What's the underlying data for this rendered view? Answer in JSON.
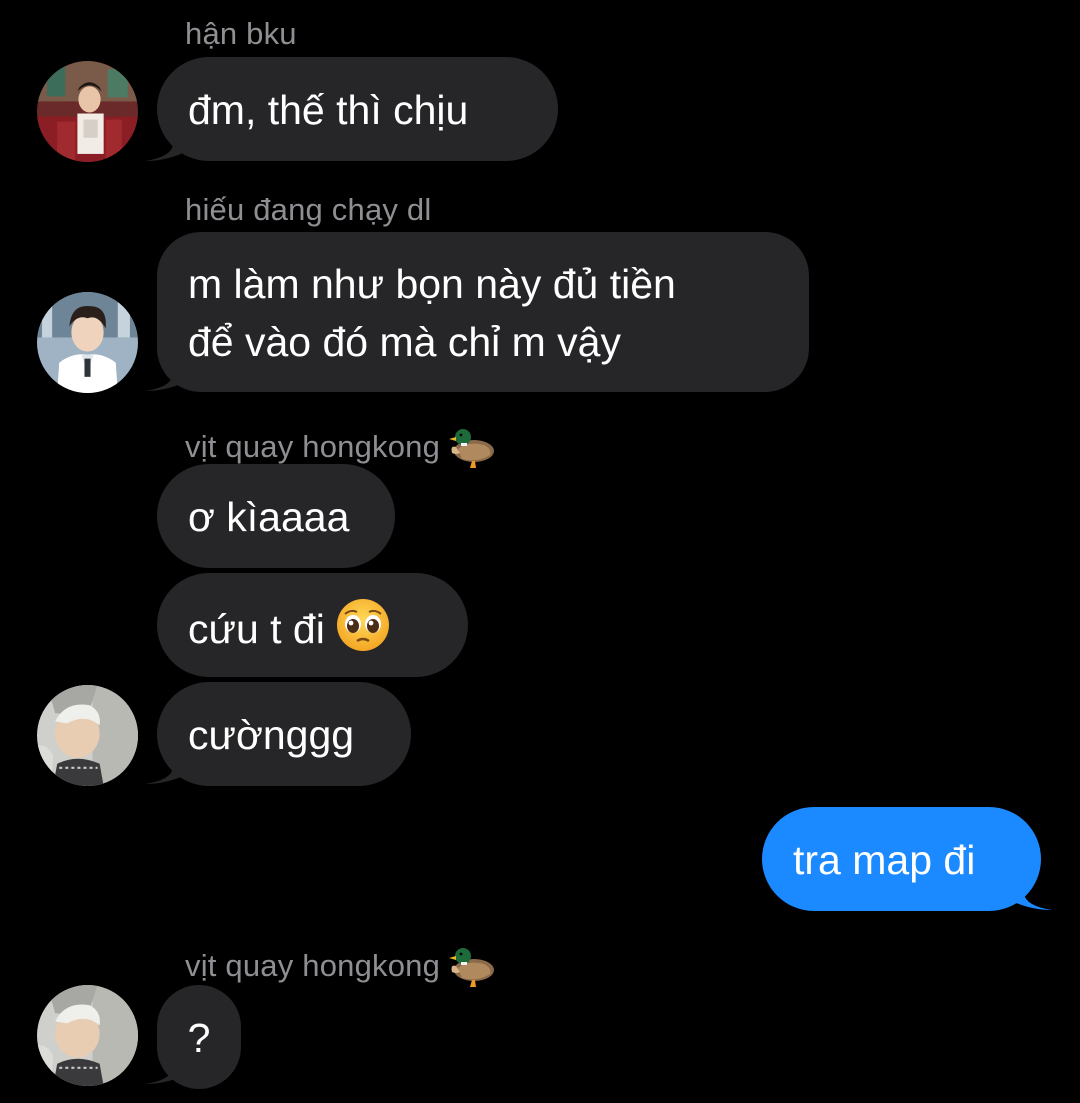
{
  "messages": [
    {
      "sender": "hận bku",
      "text": "đm, thế thì chịu"
    },
    {
      "sender": "hiếu đang chạy dl",
      "lines": [
        "m làm như bọn này đủ tiền",
        "để vào đó mà chỉ m vậy"
      ]
    },
    {
      "sender": "vịt quay hongkong",
      "sender_emoji": "duck",
      "text": "ơ kìaaaa"
    },
    {
      "text": "cứu t đi",
      "emoji": "pleading-face"
    },
    {
      "text": "cườnggg"
    },
    {
      "outgoing": true,
      "text": "tra map đi"
    },
    {
      "sender": "vịt quay hongkong",
      "sender_emoji": "duck",
      "text": "?"
    }
  ],
  "colors": {
    "background": "#000000",
    "incoming_bubble": "#262628",
    "outgoing_bubble": "#1b89ff",
    "sender_name": "#8e8e93",
    "text": "#ffffff"
  }
}
